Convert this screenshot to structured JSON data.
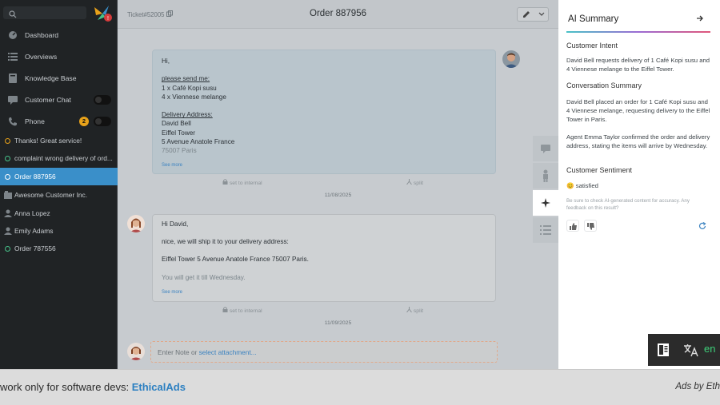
{
  "sidebar": {
    "nav": [
      {
        "label": "Dashboard",
        "icon": "dashboard-icon"
      },
      {
        "label": "Overviews",
        "icon": "list-icon"
      },
      {
        "label": "Knowledge Base",
        "icon": "book-icon"
      },
      {
        "label": "Customer Chat",
        "icon": "chat-icon"
      },
      {
        "label": "Phone",
        "icon": "phone-icon",
        "badge": "2"
      }
    ],
    "tickets": [
      {
        "label": "Thanks! Great service!",
        "status": "pending"
      },
      {
        "label": "complaint wrong delivery of ord...",
        "status": "open"
      },
      {
        "label": "Order 887956",
        "status": "open",
        "active": true
      },
      {
        "label": "Awesome Customer Inc.",
        "type": "organization"
      },
      {
        "label": "Anna Lopez",
        "type": "user"
      },
      {
        "label": "Emily Adams",
        "type": "user"
      },
      {
        "label": "Order 787556",
        "status": "open"
      }
    ]
  },
  "header": {
    "ticket_number": "Ticket#52005",
    "title": "Order 887956"
  },
  "messages": [
    {
      "lines": [
        "Hi,",
        "",
        "please send me:",
        "1 x Café Kopi susu",
        "4 x Viennese melange",
        "",
        "Delivery Address:",
        "David Bell",
        "Eiffel Tower",
        "5 Avenue Anatole France",
        "75007 Paris"
      ],
      "see_more": "See more",
      "meta_internal": "set to internal",
      "meta_split": "split",
      "date": "11/08/2025"
    },
    {
      "lines": [
        "Hi David,",
        "nice, we will ship it to your delivery address:",
        "Eiffel Tower 5 Avenue Anatole France 75007 Paris.",
        "You will get it till Wednesday."
      ],
      "see_more": "See more",
      "meta_internal": "set to internal",
      "meta_split": "split",
      "date": "11/09/2025"
    }
  ],
  "compose": {
    "placeholder": "Enter Note or ",
    "link": "select attachment..."
  },
  "ai_panel": {
    "title": "AI Summary",
    "intent_heading": "Customer Intent",
    "intent_text": "David Bell requests delivery of 1 Café Kopi susu and 4 Viennese melange to the Eiffel Tower.",
    "summary_heading": "Conversation Summary",
    "summary_p1": "David Bell placed an order for 1 Café Kopi susu and 4 Viennese melange, requesting delivery to the Eiffel Tower in Paris.",
    "summary_p2": "Agent Emma Taylor confirmed the order and delivery address, stating the items will arrive by Wednesday.",
    "sentiment_heading": "Customer Sentiment",
    "sentiment_emoji": "😊",
    "sentiment_value": "satisfied",
    "note": "Be sure to check AI-generated content for accuracy. Any feedback on this result?"
  },
  "translate": {
    "lang": "en"
  },
  "ad": {
    "text": "work only for software devs: ",
    "link": "EthicalAds",
    "by": "Ads by Eth"
  },
  "colors": {
    "accent": "#3a8fc9",
    "pending": "#e8a21a",
    "open": "#47c28a"
  }
}
